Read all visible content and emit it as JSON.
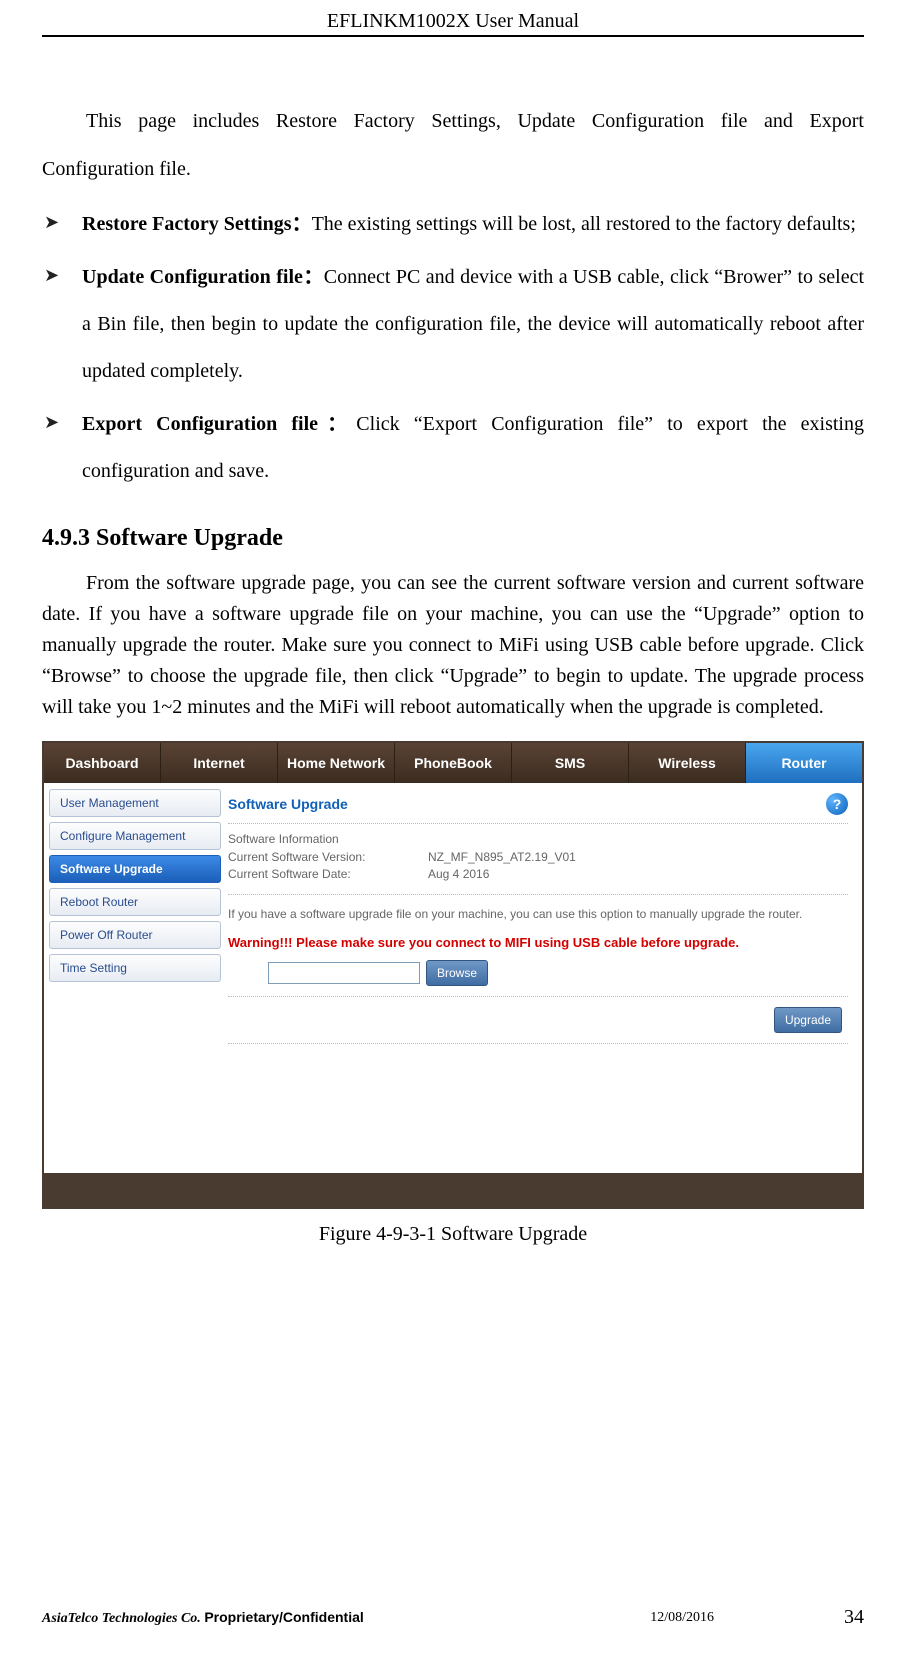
{
  "header": {
    "title": "EFLINKM1002X User Manual"
  },
  "content": {
    "intro": "This page includes Restore Factory Settings, Update Configuration file and Export Configuration file.",
    "bullets": [
      {
        "title": "Restore Factory Settings：",
        "text": "The existing settings will be lost, all restored to the factory defaults;"
      },
      {
        "title": "Update Configuration file：",
        "text": "Connect PC and device with a USB cable, click “Brower” to select a Bin file, then begin to update the configuration file, the device will automatically reboot after updated completely."
      },
      {
        "title": "Export Configuration file：",
        "text": "Click “Export Configuration file” to export the existing configuration and save."
      }
    ],
    "section_title": "4.9.3 Software Upgrade",
    "section_para": "From the software upgrade page, you can see the current software version and current software date. If you have a software upgrade file on your machine, you can use the “Upgrade” option to manually upgrade the router. Make sure you connect to MiFi using USB cable before upgrade. Click “Browse” to choose the upgrade file, then click “Upgrade” to begin to update. The upgrade process will take you 1~2 minutes and the MiFi will reboot automatically when the upgrade is completed.",
    "figure_caption": "Figure 4-9-3-1 Software Upgrade"
  },
  "shot": {
    "nav": [
      "Dashboard",
      "Internet",
      "Home Network",
      "PhoneBook",
      "SMS",
      "Wireless",
      "Router"
    ],
    "side": [
      "User Management",
      "Configure Management",
      "Software Upgrade",
      "Reboot Router",
      "Power Off Router",
      "Time Setting"
    ],
    "panel": {
      "title": "Software Upgrade",
      "info_heading": "Software Information",
      "version_label": "Current Software Version:",
      "version_value": "NZ_MF_N895_AT2.19_V01",
      "date_label": "Current Software Date:",
      "date_value": "Aug 4 2016",
      "hint": "If you have a software upgrade file on your machine, you can use this option to manually upgrade the router.",
      "warning": "Warning!!! Please make sure you connect to MIFI using USB cable before upgrade.",
      "browse": "Browse",
      "upgrade": "Upgrade"
    }
  },
  "footer": {
    "company": "AsiaTelco Technologies Co. ",
    "confidential": "Proprietary/Confidential",
    "date": "12/08/2016",
    "page": "34"
  }
}
